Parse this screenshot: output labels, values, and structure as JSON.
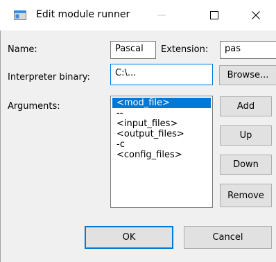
{
  "window": {
    "title": "Edit module runner",
    "controls": {
      "minimize": "—",
      "maximize": "□",
      "close": "✕"
    }
  },
  "labels": {
    "name": "Name:",
    "extension": "Extension:",
    "interpreter": "Interpreter binary:",
    "arguments": "Arguments:"
  },
  "fields": {
    "name_value": "Pascal",
    "extension_value": "pas",
    "interpreter_value": "C:\\..."
  },
  "buttons": {
    "browse": "Browse...",
    "add": "Add",
    "up": "Up",
    "down": "Down",
    "remove": "Remove",
    "ok": "OK",
    "cancel": "Cancel"
  },
  "arguments": {
    "items": [
      "<mod_file>",
      "--",
      "<input_files>",
      "<output_files>",
      "-c",
      "<config_files>"
    ],
    "selected_index": 0
  },
  "colors": {
    "accent": "#0078d7",
    "selection_text": "#ffffff",
    "window_bg": "#f0f0f0"
  },
  "icons": {
    "app": "window-app-icon",
    "minimize": "minimize-icon",
    "maximize": "maximize-icon",
    "close": "close-icon"
  }
}
